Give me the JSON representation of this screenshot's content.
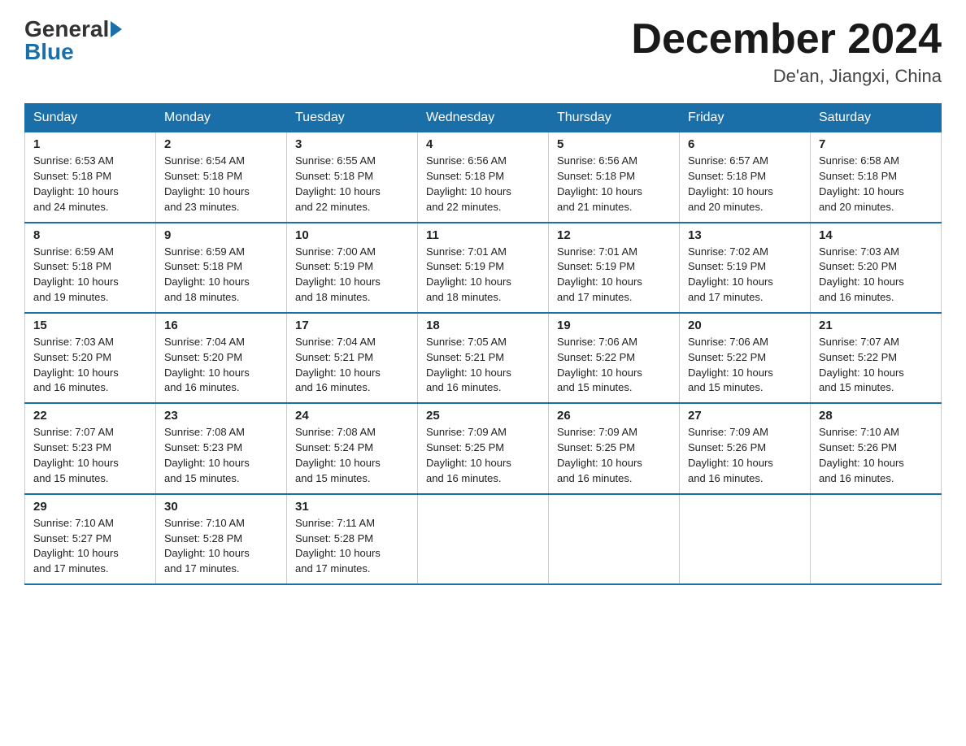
{
  "header": {
    "logo_general": "General",
    "logo_blue": "Blue",
    "title": "December 2024",
    "location": "De'an, Jiangxi, China"
  },
  "days_of_week": [
    "Sunday",
    "Monday",
    "Tuesday",
    "Wednesday",
    "Thursday",
    "Friday",
    "Saturday"
  ],
  "weeks": [
    [
      {
        "day": "1",
        "sunrise": "6:53 AM",
        "sunset": "5:18 PM",
        "daylight": "10 hours and 24 minutes."
      },
      {
        "day": "2",
        "sunrise": "6:54 AM",
        "sunset": "5:18 PM",
        "daylight": "10 hours and 23 minutes."
      },
      {
        "day": "3",
        "sunrise": "6:55 AM",
        "sunset": "5:18 PM",
        "daylight": "10 hours and 22 minutes."
      },
      {
        "day": "4",
        "sunrise": "6:56 AM",
        "sunset": "5:18 PM",
        "daylight": "10 hours and 22 minutes."
      },
      {
        "day": "5",
        "sunrise": "6:56 AM",
        "sunset": "5:18 PM",
        "daylight": "10 hours and 21 minutes."
      },
      {
        "day": "6",
        "sunrise": "6:57 AM",
        "sunset": "5:18 PM",
        "daylight": "10 hours and 20 minutes."
      },
      {
        "day": "7",
        "sunrise": "6:58 AM",
        "sunset": "5:18 PM",
        "daylight": "10 hours and 20 minutes."
      }
    ],
    [
      {
        "day": "8",
        "sunrise": "6:59 AM",
        "sunset": "5:18 PM",
        "daylight": "10 hours and 19 minutes."
      },
      {
        "day": "9",
        "sunrise": "6:59 AM",
        "sunset": "5:18 PM",
        "daylight": "10 hours and 18 minutes."
      },
      {
        "day": "10",
        "sunrise": "7:00 AM",
        "sunset": "5:19 PM",
        "daylight": "10 hours and 18 minutes."
      },
      {
        "day": "11",
        "sunrise": "7:01 AM",
        "sunset": "5:19 PM",
        "daylight": "10 hours and 18 minutes."
      },
      {
        "day": "12",
        "sunrise": "7:01 AM",
        "sunset": "5:19 PM",
        "daylight": "10 hours and 17 minutes."
      },
      {
        "day": "13",
        "sunrise": "7:02 AM",
        "sunset": "5:19 PM",
        "daylight": "10 hours and 17 minutes."
      },
      {
        "day": "14",
        "sunrise": "7:03 AM",
        "sunset": "5:20 PM",
        "daylight": "10 hours and 16 minutes."
      }
    ],
    [
      {
        "day": "15",
        "sunrise": "7:03 AM",
        "sunset": "5:20 PM",
        "daylight": "10 hours and 16 minutes."
      },
      {
        "day": "16",
        "sunrise": "7:04 AM",
        "sunset": "5:20 PM",
        "daylight": "10 hours and 16 minutes."
      },
      {
        "day": "17",
        "sunrise": "7:04 AM",
        "sunset": "5:21 PM",
        "daylight": "10 hours and 16 minutes."
      },
      {
        "day": "18",
        "sunrise": "7:05 AM",
        "sunset": "5:21 PM",
        "daylight": "10 hours and 16 minutes."
      },
      {
        "day": "19",
        "sunrise": "7:06 AM",
        "sunset": "5:22 PM",
        "daylight": "10 hours and 15 minutes."
      },
      {
        "day": "20",
        "sunrise": "7:06 AM",
        "sunset": "5:22 PM",
        "daylight": "10 hours and 15 minutes."
      },
      {
        "day": "21",
        "sunrise": "7:07 AM",
        "sunset": "5:22 PM",
        "daylight": "10 hours and 15 minutes."
      }
    ],
    [
      {
        "day": "22",
        "sunrise": "7:07 AM",
        "sunset": "5:23 PM",
        "daylight": "10 hours and 15 minutes."
      },
      {
        "day": "23",
        "sunrise": "7:08 AM",
        "sunset": "5:23 PM",
        "daylight": "10 hours and 15 minutes."
      },
      {
        "day": "24",
        "sunrise": "7:08 AM",
        "sunset": "5:24 PM",
        "daylight": "10 hours and 15 minutes."
      },
      {
        "day": "25",
        "sunrise": "7:09 AM",
        "sunset": "5:25 PM",
        "daylight": "10 hours and 16 minutes."
      },
      {
        "day": "26",
        "sunrise": "7:09 AM",
        "sunset": "5:25 PM",
        "daylight": "10 hours and 16 minutes."
      },
      {
        "day": "27",
        "sunrise": "7:09 AM",
        "sunset": "5:26 PM",
        "daylight": "10 hours and 16 minutes."
      },
      {
        "day": "28",
        "sunrise": "7:10 AM",
        "sunset": "5:26 PM",
        "daylight": "10 hours and 16 minutes."
      }
    ],
    [
      {
        "day": "29",
        "sunrise": "7:10 AM",
        "sunset": "5:27 PM",
        "daylight": "10 hours and 17 minutes."
      },
      {
        "day": "30",
        "sunrise": "7:10 AM",
        "sunset": "5:28 PM",
        "daylight": "10 hours and 17 minutes."
      },
      {
        "day": "31",
        "sunrise": "7:11 AM",
        "sunset": "5:28 PM",
        "daylight": "10 hours and 17 minutes."
      },
      null,
      null,
      null,
      null
    ]
  ],
  "labels": {
    "sunrise": "Sunrise:",
    "sunset": "Sunset:",
    "daylight": "Daylight:"
  }
}
